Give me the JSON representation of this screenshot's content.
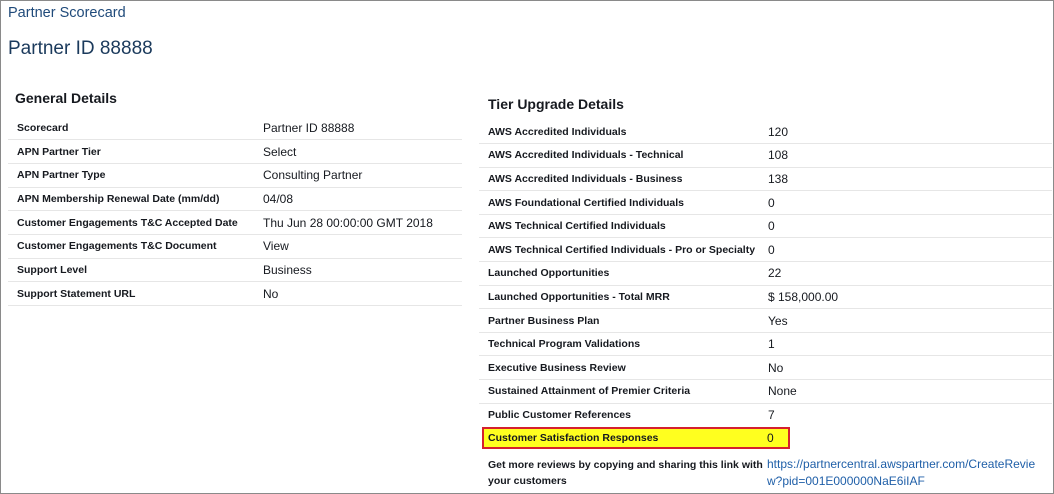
{
  "breadcrumb": "Partner Scorecard",
  "page_title": "Partner ID 88888",
  "general": {
    "title": "General Details",
    "rows": [
      {
        "label": "Scorecard",
        "value": "Partner ID 88888"
      },
      {
        "label": "APN Partner Tier",
        "value": "Select"
      },
      {
        "label": "APN Partner Type",
        "value": "Consulting Partner"
      },
      {
        "label": "APN Membership Renewal Date (mm/dd)",
        "value": "04/08"
      },
      {
        "label": "Customer Engagements T&C Accepted Date",
        "value": "Thu Jun 28 00:00:00 GMT 2018"
      },
      {
        "label": "Customer Engagements T&C Document",
        "value": "View"
      },
      {
        "label": "Support Level",
        "value": "Business"
      },
      {
        "label": "Support Statement URL",
        "value": "No"
      }
    ]
  },
  "tier": {
    "title": "Tier Upgrade Details",
    "rows": [
      {
        "label": "AWS Accredited Individuals",
        "value": "120"
      },
      {
        "label": "AWS Accredited Individuals - Technical",
        "value": "108"
      },
      {
        "label": "AWS Accredited Individuals - Business",
        "value": "138"
      },
      {
        "label": "AWS Foundational Certified Individuals",
        "value": "0"
      },
      {
        "label": "AWS Technical Certified Individuals",
        "value": "0"
      },
      {
        "label": "AWS Technical Certified Individuals - Pro or Specialty",
        "value": "0"
      },
      {
        "label": "Launched Opportunities",
        "value": "22"
      },
      {
        "label": "Launched Opportunities - Total MRR",
        "value": "$ 158,000.00"
      },
      {
        "label": "Partner Business Plan",
        "value": "Yes"
      },
      {
        "label": "Technical Program Validations",
        "value": "1"
      },
      {
        "label": "Executive Business Review",
        "value": "No"
      },
      {
        "label": "Sustained Attainment of Premier Criteria",
        "value": "None"
      },
      {
        "label": "Public Customer References",
        "value": "7"
      }
    ],
    "highlighted": {
      "label": "Customer Satisfaction Responses",
      "value": "0"
    },
    "review": {
      "label": "Get more reviews by copying and sharing this link with your customers",
      "link": "https://partnercentral.awspartner.com/CreateReview?pid=001E000000NaE6iIAF"
    }
  },
  "colors": {
    "highlight_fill": "#ffff1f",
    "highlight_border": "#d5202e",
    "link": "#1f5fa8"
  }
}
